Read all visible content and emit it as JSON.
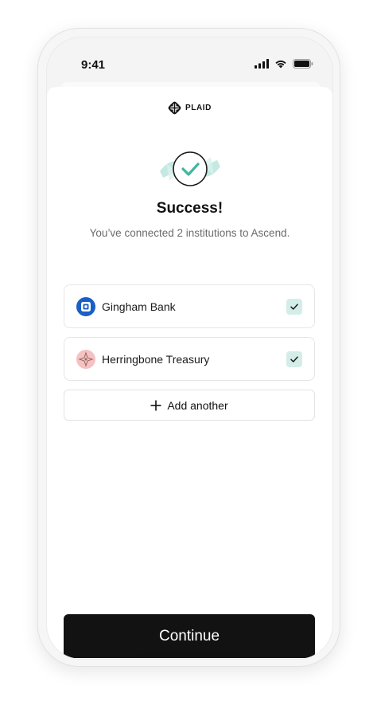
{
  "status_bar": {
    "time": "9:41",
    "icons": [
      "signal-icon",
      "wifi-icon",
      "battery-icon"
    ]
  },
  "brand": {
    "name": "PLAID",
    "icon": "plaid-logo-icon"
  },
  "success": {
    "icon": "checkmark-icon",
    "title": "Success!",
    "subtitle": "You’ve connected 2 institutions to Ascend."
  },
  "institutions": [
    {
      "name": "Gingham Bank",
      "logo": "gingham-bank-logo",
      "color": "#1a5fc4",
      "checked": true
    },
    {
      "name": "Herringbone Treasury",
      "logo": "herringbone-treasury-logo",
      "color": "#f4c2c0",
      "checked": true
    }
  ],
  "actions": {
    "add_another": "Add another",
    "continue": "Continue"
  },
  "colors": {
    "accent": "#3fb6a0",
    "check_bg": "#d5ede8",
    "primary_button": "#121212"
  }
}
